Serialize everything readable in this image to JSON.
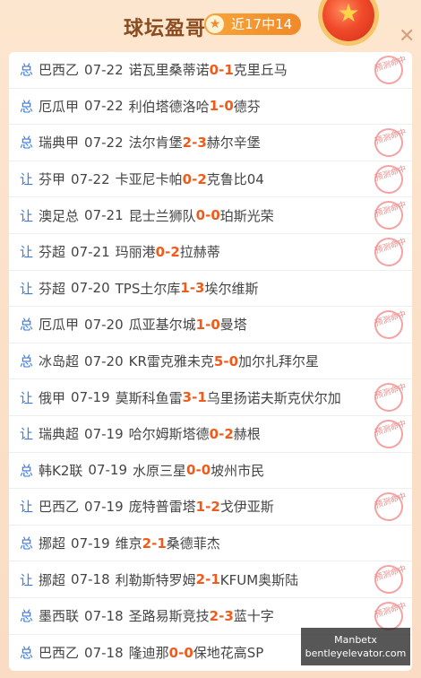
{
  "header": {
    "title": "球坛盈哥",
    "badge": "近17中14"
  },
  "rows": [
    {
      "tag": "总",
      "league": "巴西乙",
      "date": "07-22",
      "home": "诺瓦里桑蒂诺",
      "hs": "0",
      "as": "1",
      "away": "克里丘马",
      "stamp": true
    },
    {
      "tag": "总",
      "league": "厄瓜甲",
      "date": "07-22",
      "home": "利伯塔德洛哈",
      "hs": "1",
      "as": "0",
      "away": "德芬",
      "stamp": false
    },
    {
      "tag": "总",
      "league": "瑞典甲",
      "date": "07-22",
      "home": "法尔肯堡",
      "hs": "2",
      "as": "3",
      "away": "赫尔辛堡",
      "stamp": true
    },
    {
      "tag": "让",
      "league": "芬甲",
      "date": "07-22",
      "home": "卡亚尼卡帕",
      "hs": "0",
      "as": "2",
      "away": "克鲁比04",
      "stamp": true
    },
    {
      "tag": "让",
      "league": "澳足总",
      "date": "07-21",
      "home": "昆士兰狮队",
      "hs": "0",
      "as": "0",
      "away": "珀斯光荣",
      "stamp": true
    },
    {
      "tag": "让",
      "league": "芬超",
      "date": "07-21",
      "home": "玛丽港",
      "hs": "0",
      "as": "2",
      "away": "拉赫蒂",
      "stamp": true
    },
    {
      "tag": "让",
      "league": "芬超",
      "date": "07-20",
      "home": "TPS土尔库",
      "hs": "1",
      "as": "3",
      "away": "埃尔维斯",
      "stamp": false
    },
    {
      "tag": "总",
      "league": "厄瓜甲",
      "date": "07-20",
      "home": "瓜亚基尔城",
      "hs": "1",
      "as": "0",
      "away": "曼塔",
      "stamp": true
    },
    {
      "tag": "总",
      "league": "冰岛超",
      "date": "07-20",
      "home": "KR雷克雅未克",
      "hs": "5",
      "as": "0",
      "away": "加尔扎拜尔星",
      "stamp": false
    },
    {
      "tag": "让",
      "league": "俄甲",
      "date": "07-19",
      "home": "莫斯科鱼雷",
      "hs": "3",
      "as": "1",
      "away": "乌里扬诺夫斯克伏尔加",
      "stamp": true
    },
    {
      "tag": "让",
      "league": "瑞典超",
      "date": "07-19",
      "home": "哈尔姆斯塔德",
      "hs": "0",
      "as": "2",
      "away": "赫根",
      "stamp": true
    },
    {
      "tag": "总",
      "league": "韩K2联",
      "date": "07-19",
      "home": "水原三星",
      "hs": "0",
      "as": "0",
      "away": "坡州市民",
      "stamp": false
    },
    {
      "tag": "让",
      "league": "巴西乙",
      "date": "07-19",
      "home": "庞特普雷塔",
      "hs": "1",
      "as": "2",
      "away": "戈伊亚斯",
      "stamp": true
    },
    {
      "tag": "总",
      "league": "挪超",
      "date": "07-19",
      "home": "维京",
      "hs": "2",
      "as": "1",
      "away": "桑德菲杰",
      "stamp": false
    },
    {
      "tag": "让",
      "league": "挪超",
      "date": "07-18",
      "home": "利勒斯特罗姆",
      "hs": "2",
      "as": "1",
      "away": "KFUM奥斯陆",
      "stamp": true
    },
    {
      "tag": "总",
      "league": "墨西联",
      "date": "07-18",
      "home": "圣路易斯竞技",
      "hs": "2",
      "as": "3",
      "away": "蓝十字",
      "stamp": true
    },
    {
      "tag": "总",
      "league": "巴西乙",
      "date": "07-18",
      "home": "隆迪那",
      "hs": "0",
      "as": "0",
      "away": "保地花高SP",
      "stamp": false
    }
  ],
  "stamp_text": "预测命中",
  "watermark": {
    "line1": "Manbetx",
    "line2": "bentleyelevator.com"
  }
}
